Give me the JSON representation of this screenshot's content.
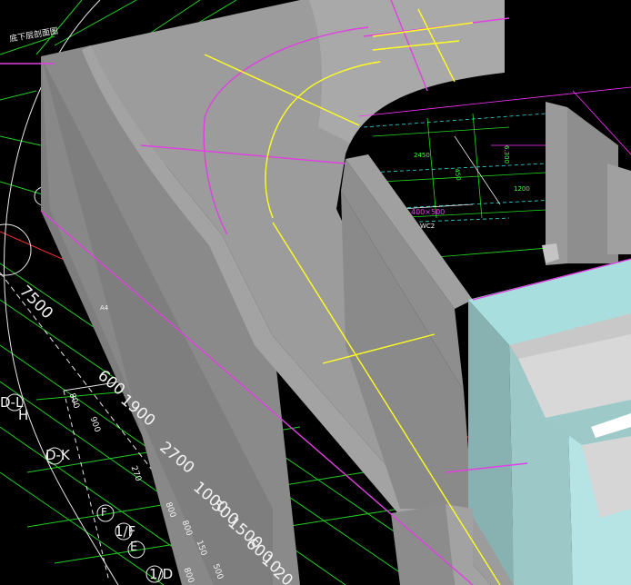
{
  "viewport": {
    "title_note": "底下层剖面图",
    "colors": {
      "background": "#000000",
      "wall_top": "#9b9b9b",
      "wall_face": "#858585",
      "slab_glass": "#a9d8d8",
      "outline_magenta": "#e040e0",
      "axis_yellow": "#ffff22",
      "grid_green": "#22dd22"
    }
  },
  "dimensions": {
    "d7500": "7500",
    "d600": "600",
    "d1900": "1900",
    "d2700": "2700",
    "d1000": "1000",
    "d500": "500",
    "d1500": "1500",
    "d600b": "600",
    "d10": "10",
    "d20": "20"
  },
  "axis_labels": {
    "dl": "D-L",
    "h": "H",
    "dk": "D-K",
    "f": "F",
    "one_f": "1/F",
    "e": "E",
    "one_d": "1/D",
    "a4": "A4"
  },
  "small_numbers": {
    "n1": "800",
    "n2": "900",
    "n3": "270",
    "n4": "800",
    "n5": "150",
    "n6": "800",
    "n7": "800",
    "n8": "500"
  },
  "plan_labels": {
    "p1": "2450",
    "p2": "400×500",
    "p3": "450",
    "p4": "6.300",
    "p5": "WC2",
    "p6": "1200"
  }
}
